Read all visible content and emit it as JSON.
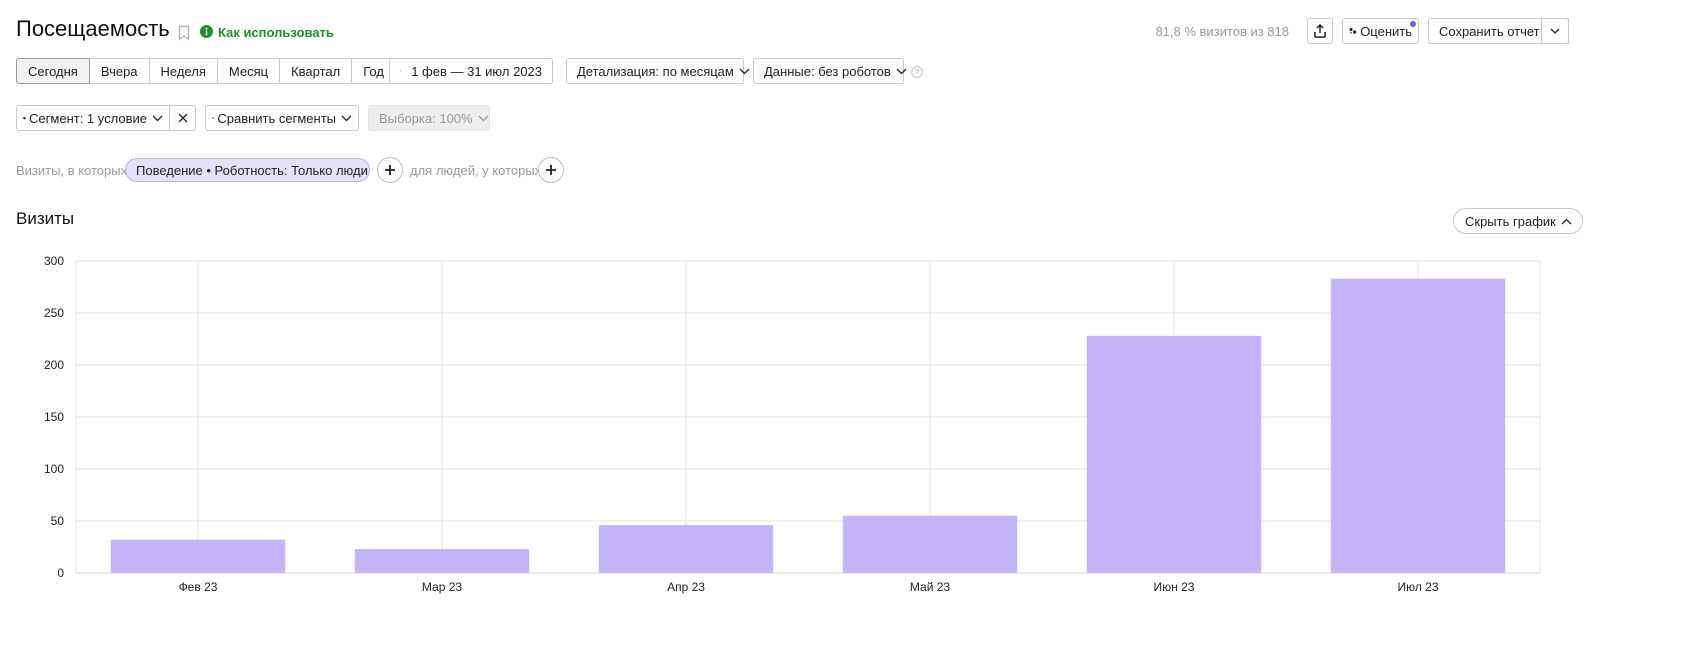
{
  "header": {
    "title": "Посещаемость",
    "how_to_use": "Как использовать",
    "visits_share": "81,8 % визитов из 818",
    "rate_label": "Оценить",
    "save_label": "Сохранить отчет"
  },
  "periods": [
    "Сегодня",
    "Вчера",
    "Неделя",
    "Месяц",
    "Квартал",
    "Год"
  ],
  "date_range": "1 фев — 31 июл 2023",
  "detail_label": "Детализация: по месяцам",
  "data_label": "Данные: без роботов",
  "segment": {
    "label": "Сегмент: 1 условие",
    "compare_label": "Сравнить сегменты",
    "sample_label": "Выборка: 100%"
  },
  "filter": {
    "prefix": "Визиты, в которых",
    "chip": "Поведение • Роботность: Только люди",
    "people_prefix": "для людей, у которых"
  },
  "chart_section": {
    "title": "Визиты",
    "hide_label": "Скрыть график"
  },
  "chart_data": {
    "type": "bar",
    "categories": [
      "Фев 23",
      "Мар 23",
      "Апр 23",
      "Май 23",
      "Июн 23",
      "Июл 23"
    ],
    "values": [
      32,
      23,
      46,
      55,
      228,
      283
    ],
    "ylim": [
      0,
      300
    ],
    "yticks": [
      0,
      50,
      100,
      150,
      200,
      250,
      300
    ],
    "grid": true,
    "bar_color": "#c3b3f7"
  },
  "colors": {
    "accent_green": "#1f8f2e",
    "chip_bg": "#e4e1fb",
    "notify_dot": "#6b5ce7"
  }
}
